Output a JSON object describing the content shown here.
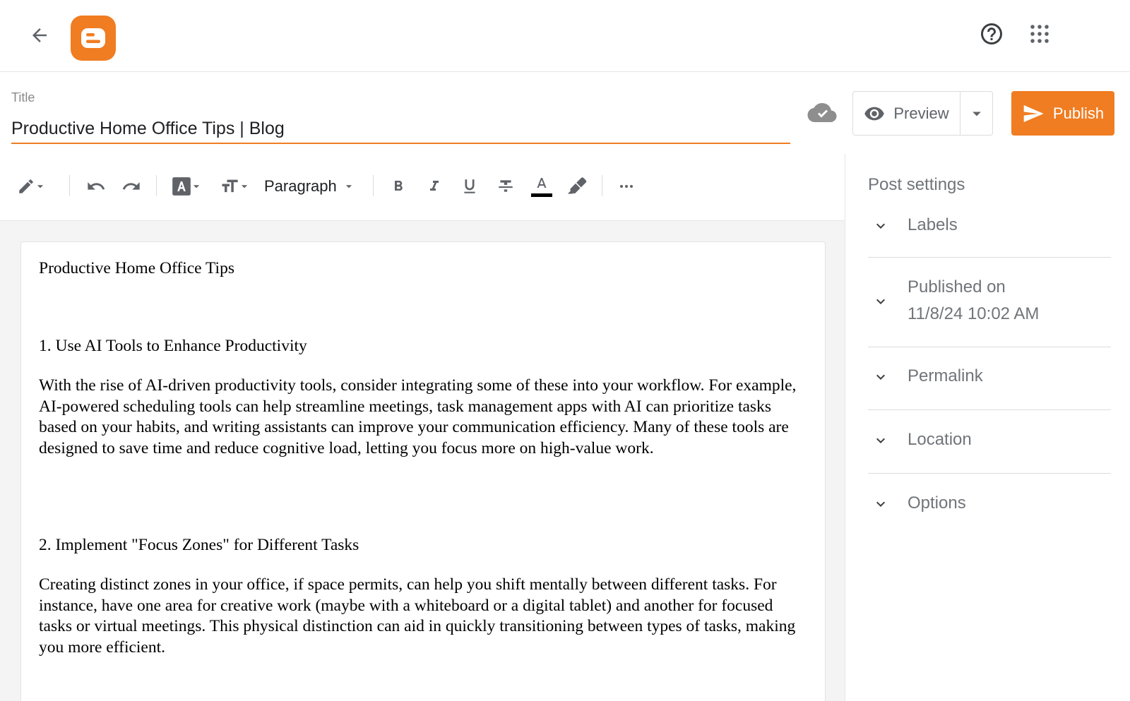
{
  "header": {
    "back_icon": "arrow-left-icon",
    "logo_icon": "blogger-logo",
    "help_icon": "help-circle-icon",
    "apps_icon": "apps-grid-icon"
  },
  "editor": {
    "title_label": "Title",
    "title_value": "Productive Home Office Tips | Blog",
    "save_status_icon": "cloud-check-icon",
    "preview_label": "Preview",
    "publish_label": "Publish",
    "accent_color": "#f07d22"
  },
  "toolbar": {
    "paragraph_label": "Paragraph"
  },
  "content": {
    "doc_title": "Productive Home Office Tips",
    "heading_1": "1. Use AI Tools to Enhance Productivity",
    "paragraph_1": "With the rise of AI-driven productivity tools, consider integrating some of these into your workflow. For example, AI-powered scheduling tools can help streamline meetings, task management apps with AI can prioritize tasks based on your habits, and writing assistants can improve your communication efficiency. Many of these tools are designed to save time and reduce cognitive load, letting you focus more on high-value work.",
    "heading_2": "2. Implement \"Focus Zones\" for Different Tasks",
    "paragraph_2": "Creating distinct zones in your office, if space permits, can help you shift mentally between different tasks. For instance, have one area for creative work (maybe with a whiteboard or a digital tablet) and another for focused tasks or virtual meetings. This physical distinction can aid in quickly transitioning between types of tasks, making you more efficient."
  },
  "post_settings": {
    "title": "Post settings",
    "labels": "Labels",
    "published_on_label": "Published on",
    "published_on_value": "11/8/24 10:02 AM",
    "permalink": "Permalink",
    "location": "Location",
    "options": "Options"
  }
}
